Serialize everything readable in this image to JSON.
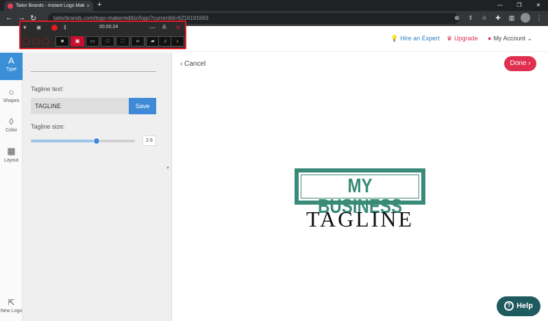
{
  "browser": {
    "tab_title": "Tailor Brands - Instant Logo Maker",
    "tab_close": "×",
    "new_tab": "+",
    "url": "tailorbrands.com/logo-maker/editor/logo?currentId=6216191663",
    "win_min": "—",
    "win_max": "❐",
    "win_close": "✕"
  },
  "recorder": {
    "timer": "00:00:24"
  },
  "header": {
    "hire_label": "Hire an Expert",
    "upgrade_label": "Upgrade",
    "account_label": "My Account"
  },
  "rail": {
    "items": [
      {
        "label": "Type",
        "icon": "A"
      },
      {
        "label": "Shapes",
        "icon": "○"
      },
      {
        "label": "Color",
        "icon": "◊"
      },
      {
        "label": "Layout",
        "icon": "▦"
      }
    ],
    "new_logo_label": "New Logo"
  },
  "panel": {
    "tagline_text_label": "Tagline text:",
    "tagline_value": "TAGLINE",
    "save_label": "Save",
    "tagline_size_label": "Tagline size:",
    "tagline_size_value": "2.6",
    "slider_fraction": 0.63
  },
  "canvas": {
    "cancel_label": "Cancel",
    "done_label": "Done",
    "logo_main_text": "MY BUSINESS",
    "logo_tagline_text": "TAGLINE"
  },
  "help_label": "Help",
  "colors": {
    "brand_red": "#e0304f",
    "accent_blue": "#3f8ad6",
    "logo_green": "#3a8a78",
    "help_teal": "#1f5a5e"
  }
}
